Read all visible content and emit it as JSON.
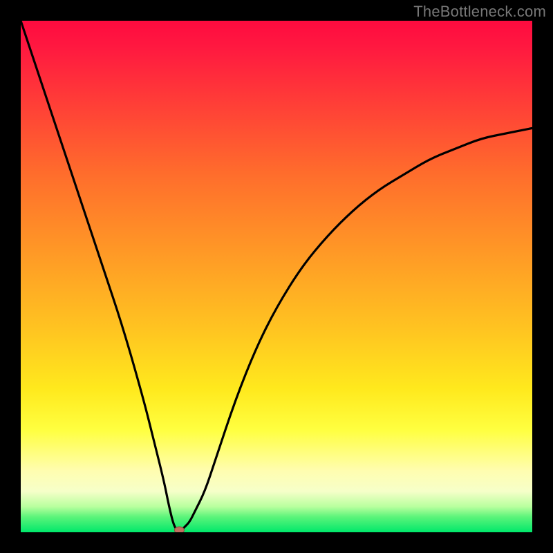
{
  "watermark": "TheBottleneck.com",
  "chart_data": {
    "type": "line",
    "title": "",
    "xlabel": "",
    "ylabel": "",
    "xlim": [
      0,
      100
    ],
    "ylim": [
      0,
      100
    ],
    "grid": false,
    "legend": false,
    "background_gradient": {
      "orientation": "vertical",
      "stops": [
        {
          "pos": 0.0,
          "color": "#ff0b3f"
        },
        {
          "pos": 0.3,
          "color": "#ff6d2c"
        },
        {
          "pos": 0.6,
          "color": "#ffc321"
        },
        {
          "pos": 0.8,
          "color": "#ffff40"
        },
        {
          "pos": 0.95,
          "color": "#b8ff9e"
        },
        {
          "pos": 1.0,
          "color": "#00e86b"
        }
      ]
    },
    "series": [
      {
        "name": "bottleneck-curve",
        "x": [
          0,
          4,
          8,
          12,
          16,
          20,
          24,
          26,
          28,
          29,
          30,
          31,
          32,
          33,
          34,
          36,
          38,
          42,
          46,
          50,
          55,
          60,
          65,
          70,
          75,
          80,
          85,
          90,
          95,
          100
        ],
        "y": [
          100,
          88,
          76,
          64,
          52,
          40,
          26,
          18,
          10,
          5,
          1,
          0,
          1,
          2,
          4,
          8,
          14,
          26,
          36,
          44,
          52,
          58,
          63,
          67,
          70,
          73,
          75,
          77,
          78,
          79
        ]
      }
    ],
    "annotations": [
      {
        "name": "min-point-marker",
        "x": 31,
        "y": 0,
        "shape": "dot",
        "color": "#c17060"
      }
    ]
  }
}
